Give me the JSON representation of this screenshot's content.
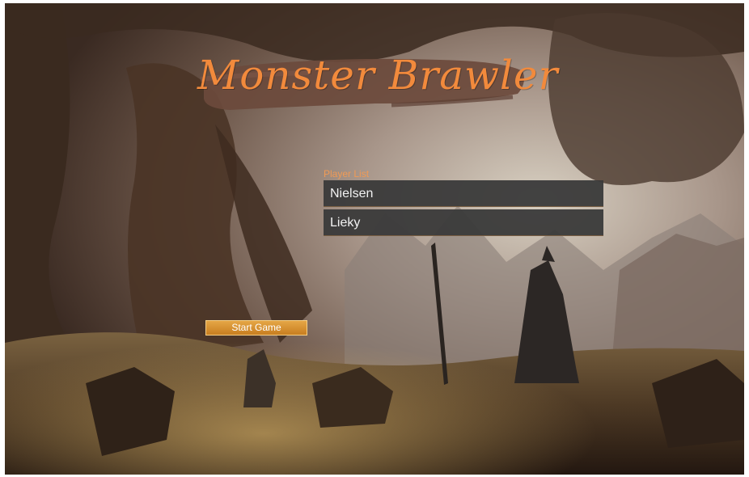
{
  "game": {
    "title": "Monster Brawler",
    "player_list_label": "Player List",
    "players": [
      "Nielsen",
      "Lieky"
    ],
    "start_button_label": "Start Game"
  },
  "colors": {
    "title_orange": "#f28a3c",
    "title_banner": "#6b4a3c",
    "list_row_bg": "#3a3a3a",
    "button_gold": "#d89330"
  }
}
